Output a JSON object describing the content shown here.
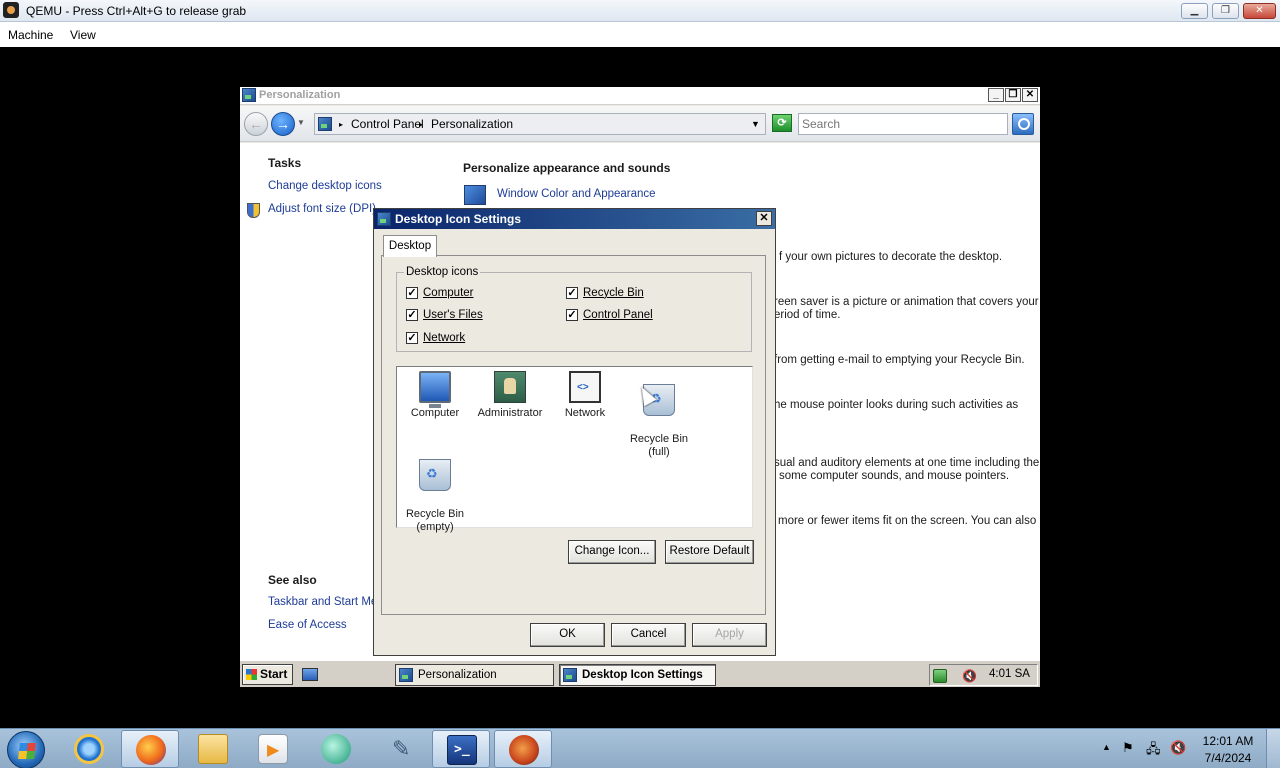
{
  "qemu": {
    "title": "QEMU - Press Ctrl+Alt+G to release grab",
    "menu": [
      "Machine",
      "View"
    ]
  },
  "personalization": {
    "title": "Personalization",
    "breadcrumb": [
      "Control Panel",
      "Personalization"
    ],
    "search_placeholder": "Search",
    "tasks_heading": "Tasks",
    "tasks": [
      "Change desktop icons",
      "Adjust font size (DPI)"
    ],
    "see_also_heading": "See also",
    "see_also": [
      "Taskbar and Start Menu",
      "Ease of Access"
    ],
    "main_heading": "Personalize appearance and sounds",
    "first_item": "Window Color and Appearance",
    "fragments": [
      "f your own pictures to decorate the desktop.",
      "reen saver is a picture or animation that covers your",
      "eriod of time.",
      "from getting e-mail to emptying your Recycle Bin.",
      "he mouse pointer looks during such activities as",
      "sual and auditory elements at one time including the",
      "some computer sounds, and mouse pointers.",
      "more or fewer items fit on the screen. You can also"
    ]
  },
  "dialog": {
    "title": "Desktop Icon Settings",
    "tab": "Desktop",
    "group_label": "Desktop icons",
    "checkboxes": [
      {
        "label": "Computer",
        "checked": true
      },
      {
        "label": "User's Files",
        "checked": true
      },
      {
        "label": "Network",
        "checked": true
      },
      {
        "label": "Recycle Bin",
        "checked": true
      },
      {
        "label": "Control Panel",
        "checked": true
      }
    ],
    "icons": [
      {
        "label": "Computer",
        "icon": "computer-icon"
      },
      {
        "label": "Administrator",
        "icon": "user-folder-icon"
      },
      {
        "label": "Network",
        "icon": "network-icon"
      },
      {
        "label": "Recycle Bin\n(full)",
        "icon": "recycle-bin-full-icon"
      },
      {
        "label": "Recycle Bin\n(empty)",
        "icon": "recycle-bin-empty-icon"
      }
    ],
    "change_icon": "Change Icon...",
    "restore_default": "Restore Default",
    "ok": "OK",
    "cancel": "Cancel",
    "apply": "Apply"
  },
  "guest_taskbar": {
    "start": "Start",
    "tasks": [
      "Personalization",
      "Desktop Icon Settings"
    ],
    "clock": "4:01 SA"
  },
  "host_taskbar": {
    "apps": [
      "internet-explorer-icon",
      "firefox-icon",
      "file-explorer-icon",
      "media-player-icon",
      "chat-app-icon",
      "tools-icon",
      "powershell-icon",
      "qemu-icon"
    ],
    "time": "12:01 AM",
    "date": "7/4/2024"
  }
}
